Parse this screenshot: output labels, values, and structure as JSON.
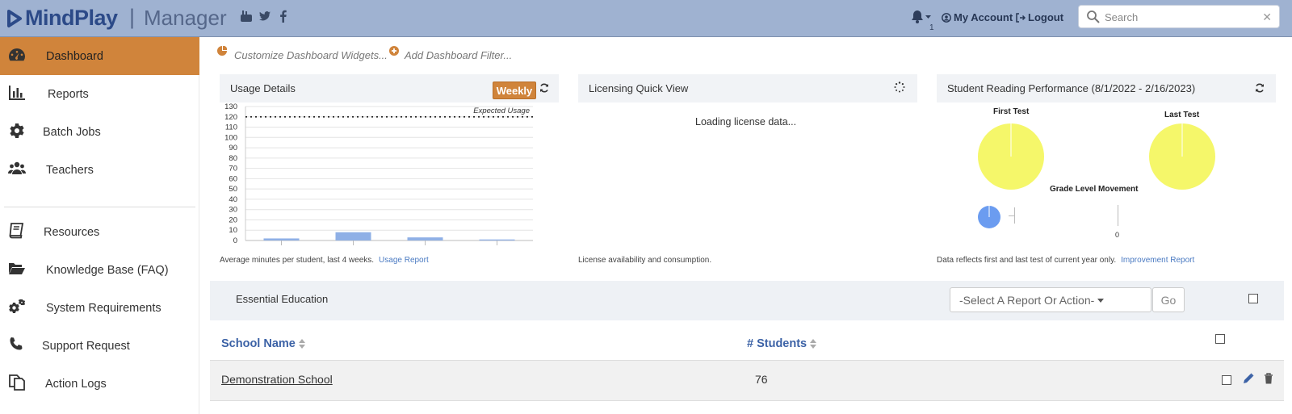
{
  "header": {
    "logo_text": "MindPlay",
    "separator": "|",
    "app_name": "Manager",
    "notification_count": "1",
    "my_account_label": "My Account",
    "logout_label": "Logout",
    "search_placeholder": "Search"
  },
  "sidebar": {
    "items": [
      {
        "label": "Dashboard",
        "icon": "dashboard-icon",
        "active": true
      },
      {
        "label": "Reports",
        "icon": "bar-chart-icon"
      },
      {
        "label": "Batch Jobs",
        "icon": "gear-icon"
      },
      {
        "label": "Teachers",
        "icon": "users-icon"
      },
      {
        "label": "Resources",
        "icon": "book-icon"
      },
      {
        "label": "Knowledge Base (FAQ)",
        "icon": "folder-open-icon"
      },
      {
        "label": "System Requirements",
        "icon": "gears-icon"
      },
      {
        "label": "Support Request",
        "icon": "phone-icon"
      },
      {
        "label": "Action Logs",
        "icon": "copy-icon"
      }
    ]
  },
  "toolbar": {
    "customize_label": "Customize Dashboard Widgets...",
    "add_filter_label": "Add Dashboard Filter..."
  },
  "widgets": {
    "usage": {
      "title": "Usage Details",
      "period_button": "Weekly",
      "expected_label": "Expected Usage",
      "footer": "Average minutes per student, last 4 weeks.",
      "footer_link": "Usage Report"
    },
    "licensing": {
      "title": "Licensing Quick View",
      "loading": "Loading license data...",
      "footer": "License availability and consumption."
    },
    "reading": {
      "title": "Student Reading Performance (8/1/2022 - 2/16/2023)",
      "first_test": "First Test",
      "last_test": "Last Test",
      "grade_movement": "Grade Level Movement",
      "grade_zero": "0",
      "footer": "Data reflects first and last test of current year only.",
      "footer_link": "Improvement Report"
    }
  },
  "chart_data": {
    "type": "bar",
    "categories": [
      "",
      "",
      "",
      ""
    ],
    "values": [
      2,
      8,
      3,
      1
    ],
    "expected_usage": 120,
    "ylim": [
      0,
      130
    ],
    "yticks": [
      "130",
      "120",
      "110",
      "100",
      "90",
      "80",
      "70",
      "60",
      "50",
      "40",
      "30",
      "20",
      "10",
      "0"
    ],
    "colors": {
      "bar": "#8fb0e6",
      "expected": "#222"
    }
  },
  "section": {
    "org_name": "Essential Education",
    "select_placeholder": "-Select A Report Or Action-",
    "go_label": "Go"
  },
  "table": {
    "columns": [
      "School Name",
      "# Students"
    ],
    "rows": [
      {
        "school": "Demonstration School",
        "students": "76"
      }
    ]
  },
  "colors": {
    "header_bg": "#9fb2d1",
    "accent_orange": "#d0843b",
    "link_blue": "#3c62a6",
    "pie_yellow": "#f5f76a",
    "pie_blue": "#6b9cf0"
  }
}
